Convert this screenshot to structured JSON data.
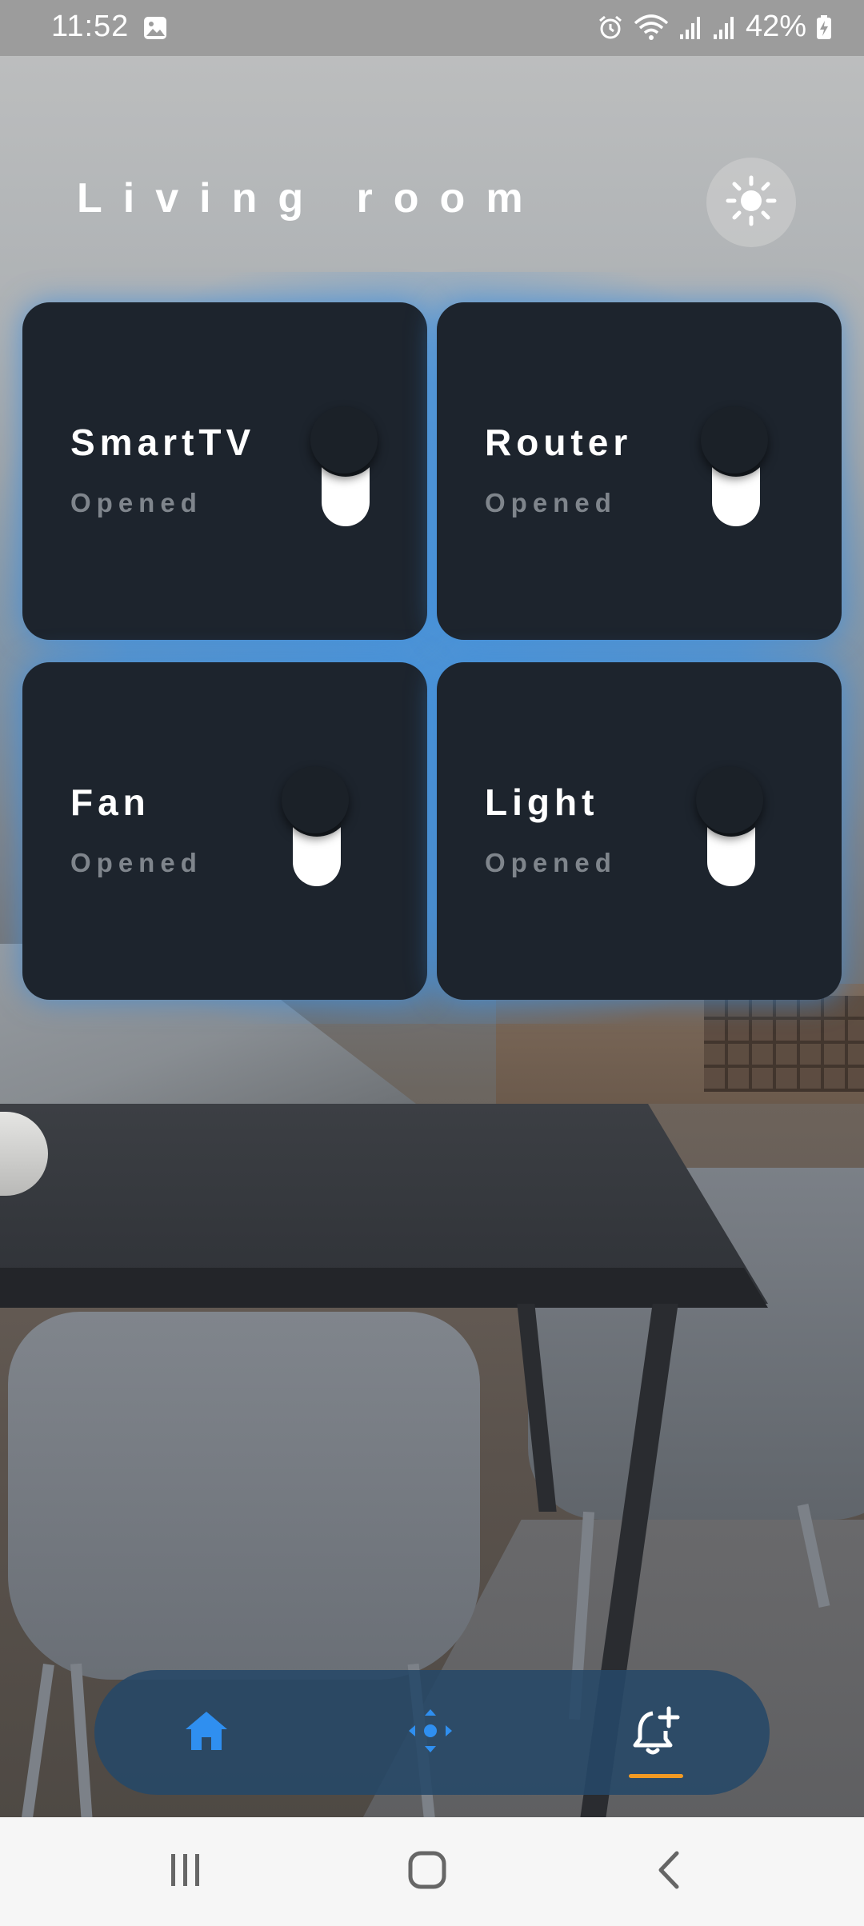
{
  "status_bar": {
    "time": "11:52",
    "battery": "42%",
    "icons": [
      "gallery-icon",
      "alarm-icon",
      "wifi-icon",
      "signal-icon",
      "signal-icon",
      "battery-charging-icon"
    ]
  },
  "header": {
    "title": "Living room",
    "theme_icon": "sun-icon"
  },
  "devices": [
    {
      "name": "SmartTV",
      "status": "Opened"
    },
    {
      "name": "Router",
      "status": "Opened"
    },
    {
      "name": "Fan",
      "status": "Opened"
    },
    {
      "name": "Light",
      "status": "Opened"
    }
  ],
  "bottom_nav": {
    "items": [
      {
        "icon": "home-icon",
        "active": false
      },
      {
        "icon": "scenes-icon",
        "active": false
      },
      {
        "icon": "bell-plus-icon",
        "active": true
      }
    ]
  },
  "colors": {
    "accent": "#2f8ff0",
    "card": "#1d242d",
    "glow": "#4696e1",
    "indicator": "#f29a23"
  },
  "system_nav": {
    "icons": [
      "recent-apps-icon",
      "home-button-icon",
      "back-icon"
    ]
  }
}
